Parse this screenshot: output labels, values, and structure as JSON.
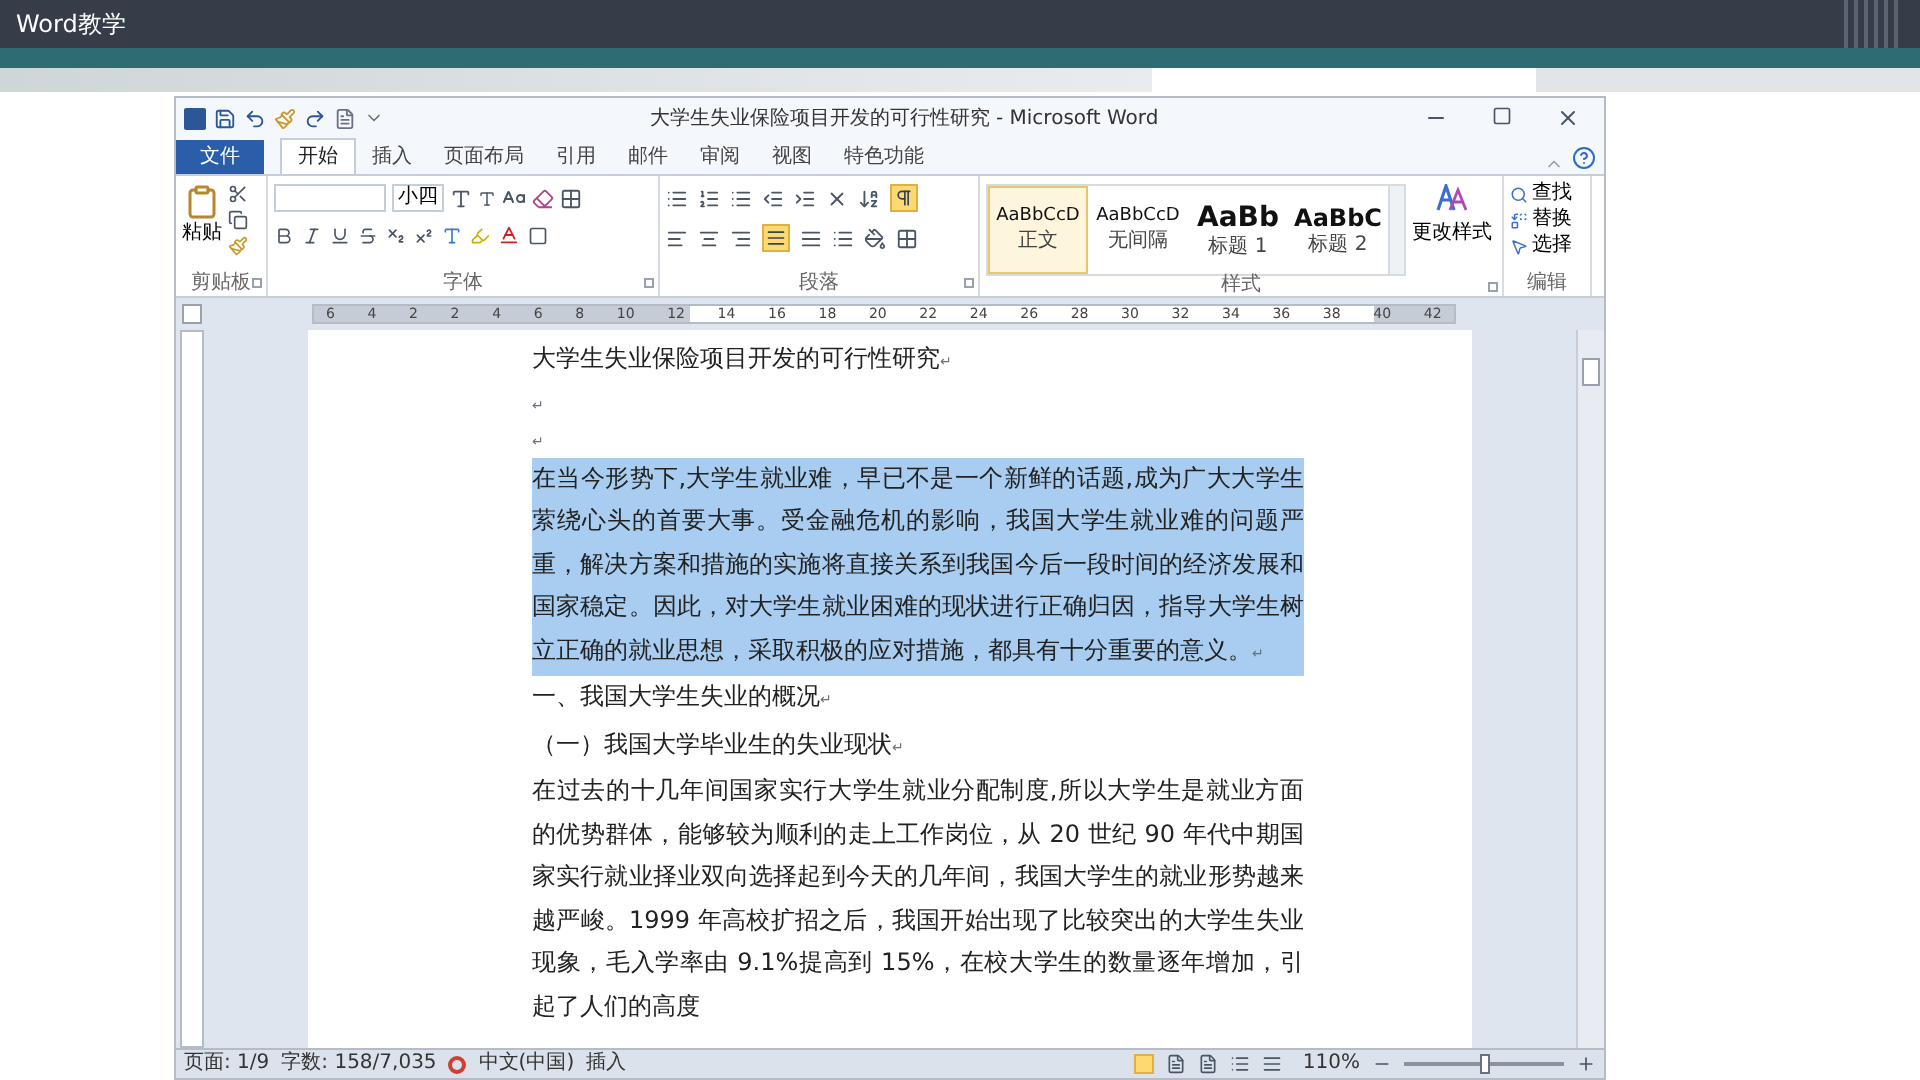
{
  "slide": {
    "title": "Word教学"
  },
  "window": {
    "title": "大学生失业保险项目开发的可行性研究 - Microsoft Word"
  },
  "ribbon_tabs": [
    {
      "label": "文件",
      "kind": "file",
      "selected": false
    },
    {
      "label": "开始",
      "kind": "tab",
      "selected": true
    },
    {
      "label": "插入",
      "kind": "tab",
      "selected": false
    },
    {
      "label": "页面布局",
      "kind": "tab",
      "selected": false
    },
    {
      "label": "引用",
      "kind": "tab",
      "selected": false
    },
    {
      "label": "邮件",
      "kind": "tab",
      "selected": false
    },
    {
      "label": "审阅",
      "kind": "tab",
      "selected": false
    },
    {
      "label": "视图",
      "kind": "tab",
      "selected": false
    },
    {
      "label": "特色功能",
      "kind": "tab",
      "selected": false
    }
  ],
  "ribbon": {
    "paste": "粘贴",
    "font_size": "小四",
    "styles": [
      {
        "preview": "AaBbCcD",
        "name": "正文",
        "kind": "normal",
        "selected": true
      },
      {
        "preview": "AaBbCcD",
        "name": "无间隔",
        "kind": "normal",
        "selected": false
      },
      {
        "preview": "AaBb",
        "name": "标题 1",
        "kind": "heading1",
        "selected": false
      },
      {
        "preview": "AaBbC",
        "name": "标题 2",
        "kind": "heading2",
        "selected": false
      }
    ],
    "change_styles": "更改样式",
    "editing": [
      "查找",
      "替换",
      "选择"
    ],
    "group_labels": [
      "剪贴板",
      "字体",
      "段落",
      "样式",
      "编辑"
    ]
  },
  "ruler": [
    "6",
    "4",
    "2",
    "2",
    "4",
    "6",
    "8",
    "10",
    "12",
    "14",
    "16",
    "18",
    "20",
    "22",
    "24",
    "26",
    "28",
    "30",
    "32",
    "34",
    "36",
    "38",
    "40",
    "42"
  ],
  "document": {
    "paragraphs": [
      {
        "text": "大学生失业保险项目开发的可行性研究",
        "mark": "↵",
        "selected": false
      },
      {
        "mark": "↵",
        "selected": false
      },
      {
        "mark": "↵",
        "selected": false
      },
      {
        "text": "在当今形势下,大学生就业难，早已不是一个新鲜的话题,成为广大大学生萦绕心头的首要大事。受金融危机的影响，我国大学生就业难的问题严重，解决方案和措施的实施将直接关系到我国今后一段时间的经济发展和国家稳定。因此，对大学生就业困难的现状进行正确归因，指导大学生树立正确的就业思想，采取积极的应对措施，都具有十分重要的意义。",
        "mark": "↵",
        "selected": true
      },
      {
        "text": "一、我国大学生失业的概况",
        "mark": "↵",
        "selected": false
      },
      {
        "text": "（一）我国大学毕业生的失业现状",
        "mark": "↵",
        "selected": false
      },
      {
        "text": "在过去的十几年间国家实行大学生就业分配制度,所以大学生是就业方面的优势群体，能够较为顺利的走上工作岗位，从 20 世纪 90 年代中期国家实行就业择业双向选择起到今天的几年间，我国大学生的就业形势越来越严峻。1999 年高校扩招之后，我国开始出现了比较突出的大学生失业现象，毛入学率由 9.1%提高到 15%，在校大学生的数量逐年增加，引起了人们的高度",
        "selected": false
      }
    ]
  },
  "status_bar": {
    "page": "页面: 1/9",
    "words": "字数: 158/7,035",
    "language": "中文(中国)",
    "mode": "插入",
    "zoom": "110%",
    "zoom_slider": {
      "level": 0.5
    }
  }
}
